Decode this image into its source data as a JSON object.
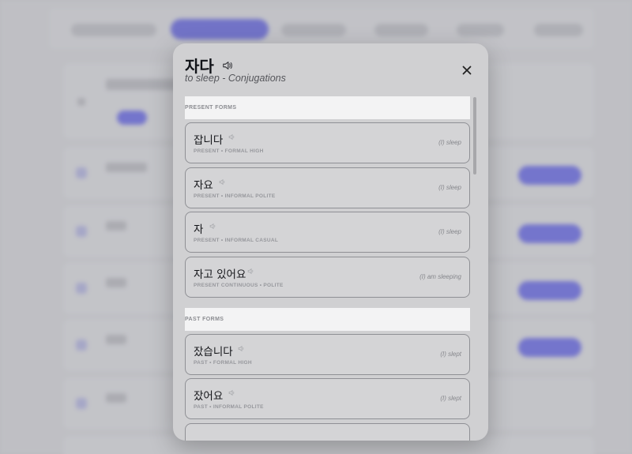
{
  "modal": {
    "title": "자다",
    "subtitle": "to sleep - Conjugations"
  },
  "sections": [
    {
      "heading": "PRESENT FORMS",
      "items": [
        {
          "korean": "잡니다",
          "form": "PRESENT • FORMAL HIGH",
          "english": "(I) sleep"
        },
        {
          "korean": "자요",
          "form": "PRESENT • INFORMAL POLITE",
          "english": "(I) sleep"
        },
        {
          "korean": "자",
          "form": "PRESENT • INFORMAL CASUAL",
          "english": "(I) sleep"
        },
        {
          "korean": "자고 있어요",
          "form": "PRESENT CONTINUOUS • POLITE",
          "english": "(I) am sleeping"
        }
      ]
    },
    {
      "heading": "PAST FORMS",
      "items": [
        {
          "korean": "잤습니다",
          "form": "PAST • FORMAL HIGH",
          "english": "(I) slept"
        },
        {
          "korean": "잤어요",
          "form": "PAST • INFORMAL POLITE",
          "english": "(I) slept"
        }
      ]
    }
  ],
  "colors": {
    "accent": "#5a5bd9",
    "modal_bg": "#d0d0d2"
  }
}
